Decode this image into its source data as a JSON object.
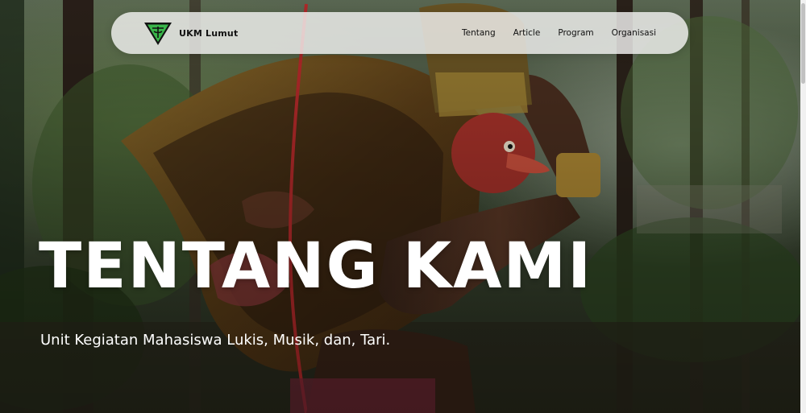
{
  "brand": {
    "name": "UKM Lumut"
  },
  "nav": {
    "items": [
      {
        "label": "Tentang"
      },
      {
        "label": "Article"
      },
      {
        "label": "Program"
      },
      {
        "label": "Organisasi"
      }
    ]
  },
  "hero": {
    "title": "TENTANG KAMI",
    "subtitle": "Unit Kegiatan Mahasiswa Lukis, Musik, dan, Tari."
  },
  "colors": {
    "logo_green": "#39b54a",
    "navbar_bg": "#f2f2f0",
    "text_light": "#ffffff"
  },
  "icons": {
    "logo": "ukm-lumut-triangle-logo"
  }
}
